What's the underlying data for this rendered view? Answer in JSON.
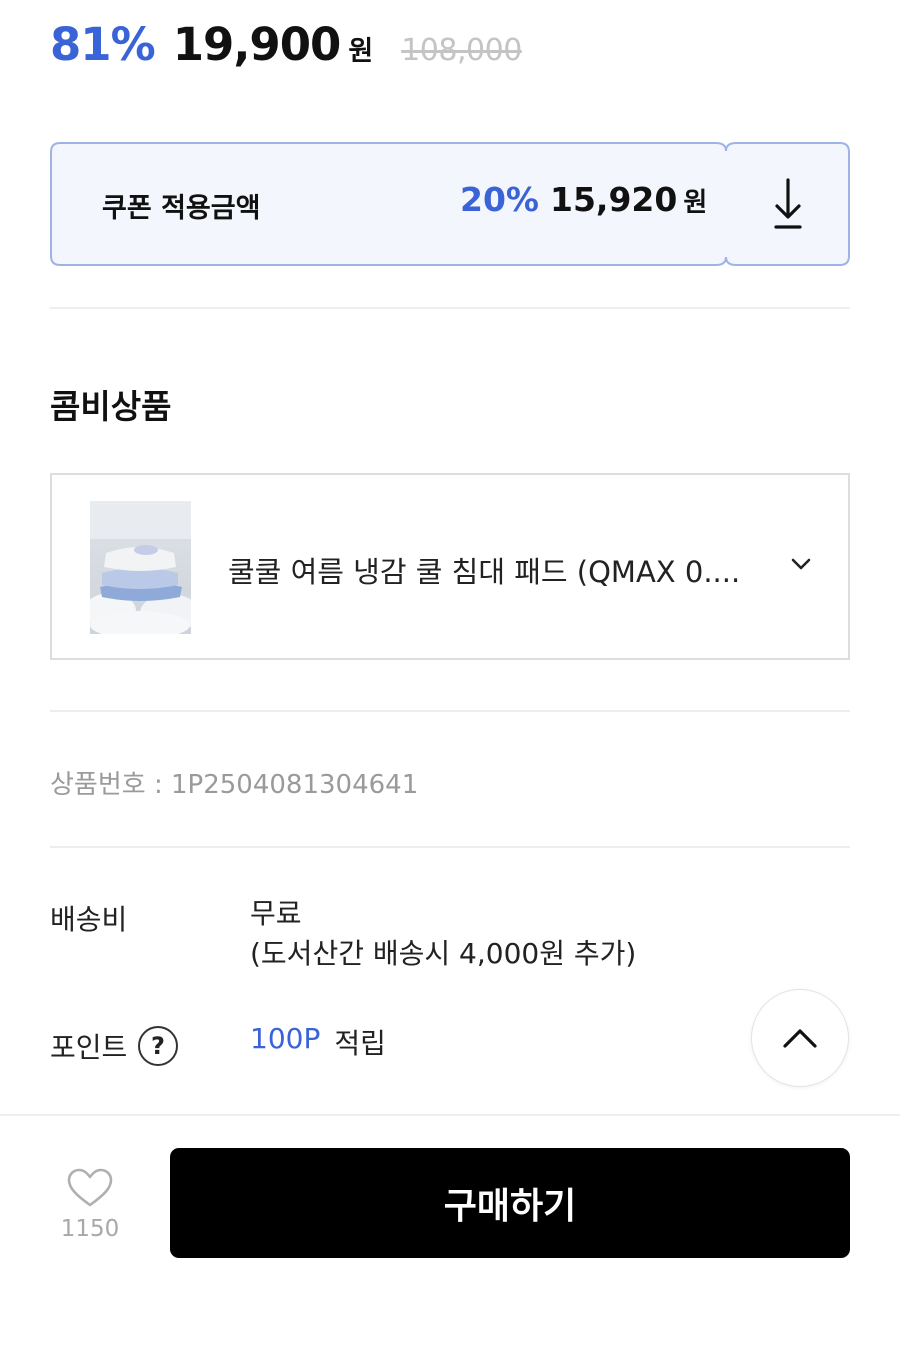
{
  "price": {
    "discount_rate": "81%",
    "sale_price": "19,900",
    "currency": "원",
    "original_price": "108,000"
  },
  "coupon": {
    "label": "쿠폰 적용금액",
    "rate": "20%",
    "price": "15,920",
    "currency": "원",
    "download_icon": "download-arrow-icon"
  },
  "combo": {
    "title": "콤비상품",
    "product_name": "쿨쿨 여름 냉감 쿨 침대 패드 (QMAX 0....",
    "expand_icon": "chevron-down-icon"
  },
  "product_number": "상품번호 : 1P2504081304641",
  "shipping": {
    "label": "배송비",
    "value": "무료",
    "note": "(도서산간 배송시 4,000원 추가)"
  },
  "points": {
    "label": "포인트",
    "help": "?",
    "amount": "100P",
    "suffix": "적립"
  },
  "bottom_bar": {
    "wish_count": "1150",
    "wish_icon": "heart-outline-icon",
    "buy_label": "구매하기"
  },
  "colors": {
    "accent": "#3a63d8",
    "coupon_bg": "#f3f6fd",
    "coupon_border": "#9fb3e6",
    "buy_button": "#000000"
  }
}
